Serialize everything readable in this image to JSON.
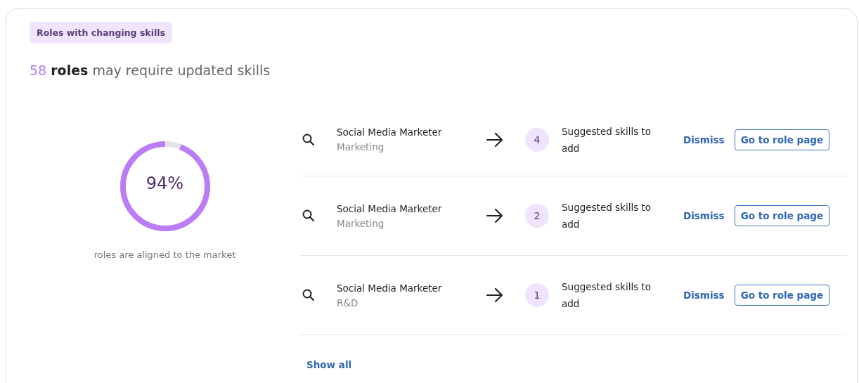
{
  "tag": "Roles with changing skills",
  "headline": {
    "count": "58",
    "noun": "roles",
    "rest": "may require updated skills"
  },
  "alignment": {
    "level": 0.94,
    "value": "94%",
    "caption": "roles are aligned to the market"
  },
  "roles": [
    {
      "title": "Social Media Marketer",
      "department": "Marketing",
      "count": "4",
      "suggestion": "Suggested skills to add",
      "dismiss": "Dismiss",
      "action": "Go to role page"
    },
    {
      "title": "Social Media Marketer",
      "department": "Marketing",
      "count": "2",
      "suggestion": "Suggested skills to add",
      "dismiss": "Dismiss",
      "action": "Go to role page"
    },
    {
      "title": "Social Media Marketer",
      "department": "R&D",
      "count": "1",
      "suggestion": "Suggested skills to add",
      "dismiss": "Dismiss",
      "action": "Go to role page"
    }
  ],
  "show_all": "Show all"
}
